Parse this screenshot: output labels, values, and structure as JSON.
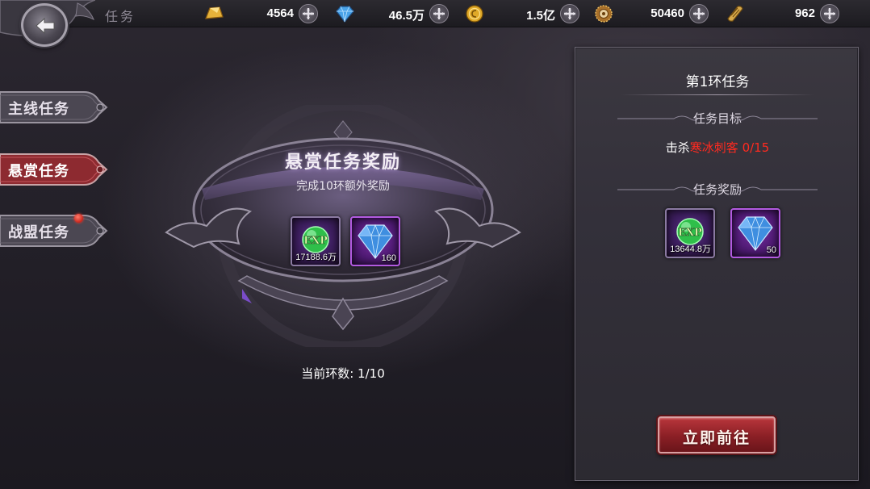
{
  "header": {
    "title": "任务",
    "resources": [
      {
        "icon": "gold-ingot-icon",
        "value": "4564"
      },
      {
        "icon": "blue-diamond-icon",
        "value": "46.5万"
      },
      {
        "icon": "gold-coin-icon",
        "value": "1.5亿"
      },
      {
        "icon": "medal-icon",
        "value": "50460"
      },
      {
        "icon": "scroll-icon",
        "value": "962"
      }
    ]
  },
  "sidebar": {
    "tabs": [
      {
        "label": "主线任务",
        "active": false
      },
      {
        "label": "悬赏任务",
        "active": true
      },
      {
        "label": "战盟任务",
        "active": false,
        "notification": true
      }
    ]
  },
  "reward_section": {
    "title": "悬赏任务奖励",
    "subtitle": "完成10环额外奖励",
    "items": [
      {
        "icon": "exp-orb-icon",
        "quantity": "17188.6万"
      },
      {
        "icon": "diamond-icon",
        "quantity": "160"
      }
    ],
    "current_ring": "当前环数: 1/10"
  },
  "quest_panel": {
    "title": "第1环任务",
    "target_heading": "任务目标",
    "target": {
      "prefix": "击杀",
      "enemy": "寒冰刺客",
      "progress": "0/15"
    },
    "reward_heading": "任务奖励",
    "rewards": [
      {
        "icon": "exp-orb-icon",
        "quantity": "13644.8万"
      },
      {
        "icon": "diamond-icon",
        "quantity": "50"
      }
    ],
    "go_button": "立即前往"
  },
  "colors": {
    "accent_red": "#ff2a1f",
    "button_red": "#a02a30",
    "panel_bg": "#35323a"
  }
}
